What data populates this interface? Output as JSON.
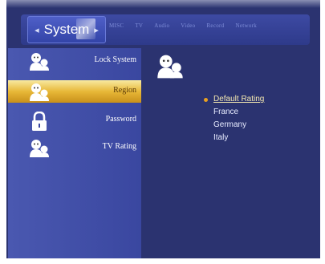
{
  "header": {
    "active_tab": "System",
    "tabs": [
      "MISC",
      "TV",
      "Audio",
      "Video",
      "Record",
      "Network"
    ]
  },
  "sidebar": {
    "items": [
      {
        "label": "Lock System",
        "icon": "user-face-icon"
      },
      {
        "label": "Region",
        "icon": "user-face-icon",
        "selected": true
      },
      {
        "label": "Password",
        "icon": "padlock-icon"
      },
      {
        "label": "TV Rating",
        "icon": "user-face-icon"
      }
    ]
  },
  "panel": {
    "icon": "user-face-icon",
    "options": [
      "Default Rating",
      "France",
      "Germany",
      "Italy"
    ],
    "selected_option": "Default Rating"
  },
  "colors": {
    "background": "#2b3370",
    "sidebar": "#4a58b0",
    "selection": "#e8b838",
    "bullet": "#e8a020"
  }
}
